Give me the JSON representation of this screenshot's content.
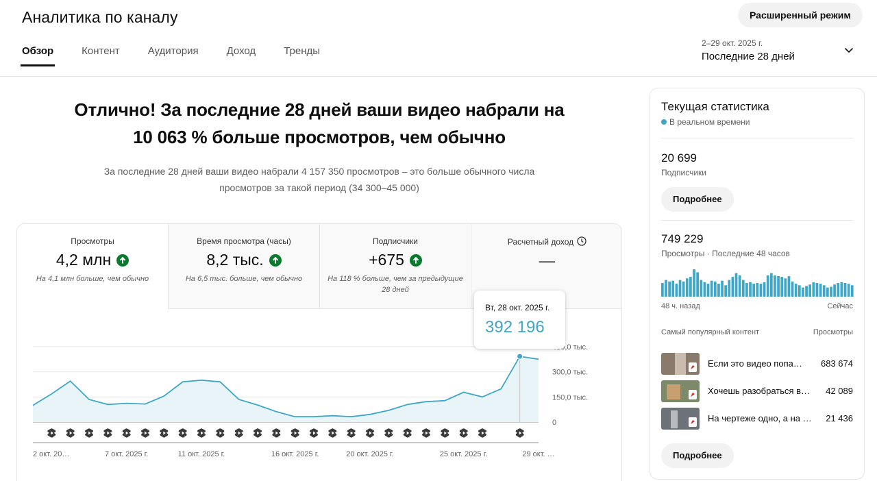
{
  "header": {
    "title": "Аналитика по каналу",
    "advanced_mode": "Расширенный режим",
    "tabs": [
      {
        "label": "Обзор",
        "active": true
      },
      {
        "label": "Контент",
        "active": false
      },
      {
        "label": "Аудитория",
        "active": false
      },
      {
        "label": "Доход",
        "active": false
      },
      {
        "label": "Тренды",
        "active": false
      }
    ],
    "period": {
      "range": "2–29 окт. 2025 г.",
      "label": "Последние 28 дней",
      "icon": "chevron-down-icon"
    }
  },
  "summary": {
    "headline_line1": "Отлично! За последние 28 дней ваши видео набрали на",
    "headline_line2": "10 063 % больше просмотров, чем обычно",
    "sub_line1": "За последние 28 дней ваши видео набрали 4 157 350 просмотров – это больше обычного числа",
    "sub_line2": "просмотров за такой период (34 300–45 000)"
  },
  "metrics": [
    {
      "label": "Просмотры",
      "value": "4,2 млн",
      "note": "На 4,1 млн больше, чем обычно",
      "trend": "up",
      "active": true
    },
    {
      "label": "Время просмотра (часы)",
      "value": "8,2 тыс.",
      "note": "На 6,5 тыс. больше, чем обычно",
      "trend": "up",
      "active": false
    },
    {
      "label": "Подписчики",
      "value": "+675",
      "note": "На 118 % больше, чем за предыдущие 28 дней",
      "trend": "up",
      "active": false
    },
    {
      "label": "Расчетный доход",
      "value": "—",
      "note": "",
      "trend": "",
      "active": false,
      "icon": "clock-icon"
    }
  ],
  "tooltip": {
    "date": "Вт, 28 окт. 2025 г.",
    "value": "392 196"
  },
  "colors": {
    "accent": "#3ea6c8",
    "up": "#0a7a2f"
  },
  "chart_data": {
    "type": "area",
    "metric": "Просмотры",
    "x": [
      "2 окт.",
      "3 окт.",
      "4 окт.",
      "5 окт.",
      "6 окт.",
      "7 окт.",
      "8 окт.",
      "9 окт.",
      "10 окт.",
      "11 окт.",
      "12 окт.",
      "13 окт.",
      "14 окт.",
      "15 окт.",
      "16 окт.",
      "17 окт.",
      "18 окт.",
      "19 окт.",
      "20 окт.",
      "21 окт.",
      "22 окт.",
      "23 окт.",
      "24 окт.",
      "25 окт.",
      "26 окт.",
      "27 окт.",
      "28 окт.",
      "29 окт."
    ],
    "values": [
      100000,
      168000,
      245000,
      135000,
      105000,
      112000,
      108000,
      155000,
      240000,
      250000,
      240000,
      135000,
      102000,
      62000,
      32000,
      32000,
      38000,
      32000,
      46000,
      70000,
      105000,
      122000,
      128000,
      178000,
      150000,
      198000,
      392196,
      375000
    ],
    "x_tick_labels": [
      "2 окт. 20…",
      "7 окт. 2025 г.",
      "11 окт. 2025 г.",
      "16 окт. 2025 г.",
      "20 окт. 2025 г.",
      "25 окт. 2025 г.",
      "29 окт. …"
    ],
    "x_tick_days": [
      0,
      5,
      9,
      14,
      18,
      23,
      27
    ],
    "y_tick_labels": [
      "0",
      "150,0 тыс.",
      "300,0 тыс.",
      "450,0 тыс."
    ],
    "y_ticks": [
      0,
      150000,
      300000,
      450000
    ],
    "ylim": [
      0,
      450000
    ],
    "highlight_day": 26,
    "upload_marker_days": [
      1,
      2,
      3,
      4,
      5,
      6,
      7,
      8,
      9,
      10,
      11,
      12,
      13,
      14,
      15,
      16,
      17,
      18,
      19,
      20,
      21,
      22,
      23,
      24,
      25,
      26
    ]
  },
  "realtime": {
    "title": "Текущая статистика",
    "live": "В реальном времени",
    "subscribers_value": "20 699",
    "subscribers_label": "Подписчики",
    "more1": "Подробнее",
    "views_value": "749 229",
    "views_label": "Просмотры · Последние 48 часов",
    "bars": [
      18,
      22,
      20,
      21,
      17,
      22,
      20,
      24,
      26,
      36,
      32,
      22,
      19,
      17,
      21,
      20,
      17,
      21,
      15,
      22,
      26,
      31,
      28,
      22,
      18,
      19,
      17,
      18,
      17,
      19,
      28,
      31,
      28,
      27,
      26,
      24,
      27,
      20,
      17,
      15,
      12,
      14,
      16,
      19,
      18,
      17,
      15,
      12,
      13,
      16,
      18,
      19,
      18,
      17,
      15
    ],
    "bars_start": "48 ч. назад",
    "bars_end": "Сейчас",
    "popular_header": "Самый популярный контент",
    "popular_metric": "Просмотры",
    "popular": [
      {
        "title": "Если это видео попа…",
        "views": "683 674"
      },
      {
        "title": "Хочешь разобраться в…",
        "views": "42 089"
      },
      {
        "title": "На чертеже одно, а на …",
        "views": "21 436"
      }
    ],
    "more2": "Подробнее"
  }
}
